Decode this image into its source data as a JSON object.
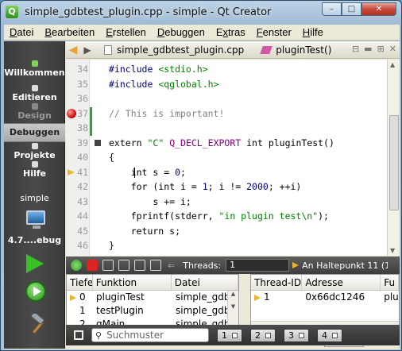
{
  "window": {
    "title": "simple_gdbtest_plugin.cpp - simple - Qt Creator",
    "app_icon": "Q",
    "min": "–",
    "max": "□",
    "close": "✕"
  },
  "menu": [
    "Datei",
    "Bearbeiten",
    "Erstellen",
    "Debuggen",
    "Extras",
    "Fenster",
    "Hilfe"
  ],
  "menu_keys": [
    "D",
    "B",
    "E",
    "D",
    "x",
    "F",
    "H"
  ],
  "modes": {
    "welcome": "Willkommen",
    "edit": "Editieren",
    "design": "Design",
    "debug": "Debuggen",
    "projects": "Projekte",
    "help": "Hilfe",
    "project_name": "simple",
    "kit": "4.7....ebug"
  },
  "editor_toolbar": {
    "file": "simple_gdbtest_plugin.cpp",
    "function": "pluginTest()"
  },
  "code_lines": [
    {
      "n": "34",
      "text": "#include <stdio.h>"
    },
    {
      "n": "35",
      "text": "#include <qglobal.h>"
    },
    {
      "n": "36",
      "text": ""
    },
    {
      "n": "37",
      "text": "// This is important!"
    },
    {
      "n": "38",
      "text": ""
    },
    {
      "n": "39",
      "text": "extern \"C\" Q_DECL_EXPORT int pluginTest()"
    },
    {
      "n": "40",
      "text": "{"
    },
    {
      "n": "41",
      "text": "    int s = 0;"
    },
    {
      "n": "42",
      "text": "    for (int i = 1; i != 2000; ++i)"
    },
    {
      "n": "43",
      "text": "        s += i;"
    },
    {
      "n": "44",
      "text": "    fprintf(stderr, \"in plugin test\\n\");"
    },
    {
      "n": "45",
      "text": "    return s;"
    },
    {
      "n": "46",
      "text": "}"
    }
  ],
  "debug_toolbar": {
    "threads_label": "Threads:",
    "threads_value": "1",
    "status": "An Haltepunkt 11 (1) ir"
  },
  "stack": {
    "headers": [
      "Tiefe",
      "Funktion",
      "Datei"
    ],
    "rows": [
      {
        "depth": "0",
        "func": "pluginTest",
        "file": "simple_gdbtes"
      },
      {
        "depth": "1",
        "func": "testPlugin",
        "file": "simple_gdbtes"
      },
      {
        "depth": "2",
        "func": "qMain",
        "file": "simple_gdbtes"
      }
    ]
  },
  "threads": {
    "headers": [
      "Thread-ID",
      "Adresse",
      "Fu"
    ],
    "rows": [
      {
        "id": "1",
        "addr": "0x66dc1246",
        "func": "plu"
      }
    ]
  },
  "tabs": [
    "okal...",
    "Halt...",
    "Thread"
  ],
  "status": {
    "search_placeholder": "Suchmuster",
    "panes": [
      "1",
      "2",
      "3",
      "4"
    ]
  },
  "colors": {
    "breakpoint": "#d21010",
    "current_line_arrow": "#e6b62e",
    "run": "#39c226"
  }
}
